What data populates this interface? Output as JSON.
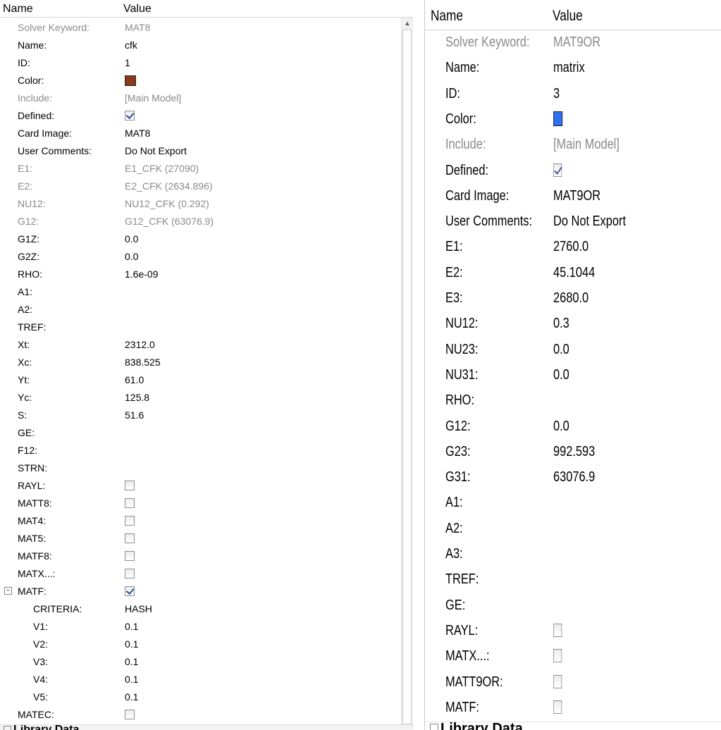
{
  "left_panel": {
    "header": {
      "name": "Name",
      "value": "Value"
    },
    "rows": [
      {
        "name": "Solver Keyword:",
        "value": "MAT8",
        "dim": true
      },
      {
        "name": "Name:",
        "value": "cfk"
      },
      {
        "name": "ID:",
        "value": "1"
      },
      {
        "name": "Color:",
        "swatch": "#8b3a1e"
      },
      {
        "name": "Include:",
        "value": "[Main Model]",
        "dim": true
      },
      {
        "name": "Defined:",
        "check": true
      },
      {
        "name": "Card Image:",
        "value": "MAT8"
      },
      {
        "name": "User Comments:",
        "value": "Do Not Export"
      },
      {
        "name": "E1:",
        "value": "E1_CFK (27090)",
        "dim": true
      },
      {
        "name": "E2:",
        "value": "E2_CFK (2634.896)",
        "dim": true
      },
      {
        "name": "NU12:",
        "value": "NU12_CFK (0.292)",
        "dim": true
      },
      {
        "name": "G12:",
        "value": "G12_CFK (63076.9)",
        "dim": true
      },
      {
        "name": "G1Z:",
        "value": "0.0"
      },
      {
        "name": "G2Z:",
        "value": "0.0"
      },
      {
        "name": "RHO:",
        "value": "1.6e-09"
      },
      {
        "name": "A1:",
        "value": ""
      },
      {
        "name": "A2:",
        "value": ""
      },
      {
        "name": "TREF:",
        "value": ""
      },
      {
        "name": "Xt:",
        "value": "2312.0"
      },
      {
        "name": "Xc:",
        "value": "838.525"
      },
      {
        "name": "Yt:",
        "value": "61.0"
      },
      {
        "name": "Yc:",
        "value": "125.8"
      },
      {
        "name": "S:",
        "value": "51.6"
      },
      {
        "name": "GE:",
        "value": ""
      },
      {
        "name": "F12:",
        "value": ""
      },
      {
        "name": "STRN:",
        "value": ""
      },
      {
        "name": "RAYL:",
        "check": false
      },
      {
        "name": "MATT8:",
        "check": false
      },
      {
        "name": "MAT4:",
        "check": false
      },
      {
        "name": "MAT5:",
        "check": false
      },
      {
        "name": "MATF8:",
        "check": false
      },
      {
        "name": "MATX...:",
        "check": false
      },
      {
        "name": "MATF:",
        "check": true,
        "toggle": "−"
      },
      {
        "name": "CRITERIA:",
        "value": "HASH",
        "indent": true
      },
      {
        "name": "V1:",
        "value": "0.1",
        "indent": true
      },
      {
        "name": "V2:",
        "value": "0.1",
        "indent": true
      },
      {
        "name": "V3:",
        "value": "0.1",
        "indent": true
      },
      {
        "name": "V4:",
        "value": "0.1",
        "indent": true
      },
      {
        "name": "V5:",
        "value": "0.1",
        "indent": true
      },
      {
        "name": "MATEC:",
        "check": false
      }
    ],
    "bottom_label": "Library Data"
  },
  "right_panel": {
    "header": {
      "name": "Name",
      "value": "Value"
    },
    "rows": [
      {
        "name": "Solver Keyword:",
        "value": "MAT9OR",
        "dim": true
      },
      {
        "name": "Name:",
        "value": "matrix"
      },
      {
        "name": "ID:",
        "value": "3"
      },
      {
        "name": "Color:",
        "swatch": "#2f6ff2"
      },
      {
        "name": "Include:",
        "value": "[Main Model]",
        "dim": true
      },
      {
        "name": "Defined:",
        "check": true
      },
      {
        "name": "Card Image:",
        "value": "MAT9OR"
      },
      {
        "name": "User Comments:",
        "value": "Do Not Export"
      },
      {
        "name": "E1:",
        "value": "2760.0"
      },
      {
        "name": "E2:",
        "value": "45.1044"
      },
      {
        "name": "E3:",
        "value": "2680.0"
      },
      {
        "name": "NU12:",
        "value": "0.3"
      },
      {
        "name": "NU23:",
        "value": "0.0"
      },
      {
        "name": "NU31:",
        "value": "0.0"
      },
      {
        "name": "RHO:",
        "value": ""
      },
      {
        "name": "G12:",
        "value": "0.0"
      },
      {
        "name": "G23:",
        "value": "992.593"
      },
      {
        "name": "G31:",
        "value": "63076.9"
      },
      {
        "name": "A1:",
        "value": ""
      },
      {
        "name": "A2:",
        "value": ""
      },
      {
        "name": "A3:",
        "value": ""
      },
      {
        "name": "TREF:",
        "value": ""
      },
      {
        "name": "GE:",
        "value": ""
      },
      {
        "name": "RAYL:",
        "check": false
      },
      {
        "name": "MATX...:",
        "check": false
      },
      {
        "name": "MATT9OR:",
        "check": false
      },
      {
        "name": "MATF:",
        "check": false
      }
    ],
    "bottom_label": "Library Data"
  }
}
